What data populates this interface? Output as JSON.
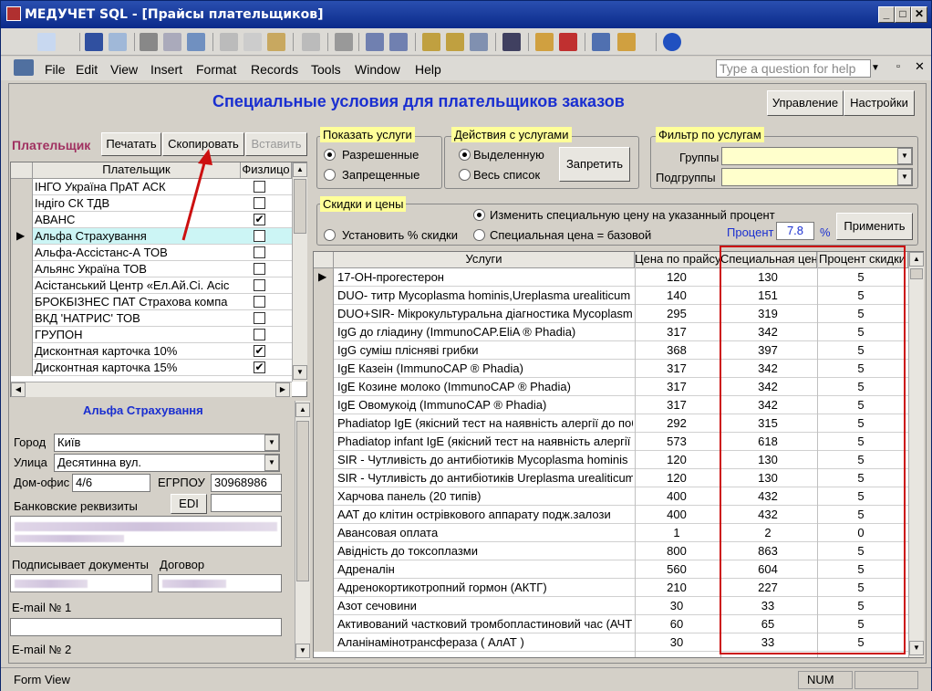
{
  "window": {
    "title": "МЕДУЧЕТ SQL - [Прайсы плательщиков]"
  },
  "menu": {
    "items": [
      "File",
      "Edit",
      "View",
      "Insert",
      "Format",
      "Records",
      "Tools",
      "Window",
      "Help"
    ],
    "ask_placeholder": "Type a question for help"
  },
  "form": {
    "title": "Специальные условия для плательщиков заказов",
    "btn_manage": "Управление",
    "btn_settings": "Настройки"
  },
  "payer_panel": {
    "label": "Плательщик",
    "btn_print": "Печатать",
    "btn_copy": "Скопировать",
    "btn_paste": "Вставить",
    "col_payer": "Плательщик",
    "col_individual": "Физлицо",
    "rows": [
      {
        "name": "ІНГО Україна ПрАТ АСК",
        "checked": false
      },
      {
        "name": "Індіго СК ТДВ",
        "checked": false
      },
      {
        "name": "АВАНС",
        "checked": true
      },
      {
        "name": "Альфа Страхування",
        "checked": false
      },
      {
        "name": "Альфа-Ассістанс-А ТОВ",
        "checked": false
      },
      {
        "name": "Альянс Україна ТОВ",
        "checked": false
      },
      {
        "name": "Асістанський Центр «Ел.Ай.Сі. Асіс",
        "checked": false
      },
      {
        "name": "БРОКБІЗНЕС ПАТ Страхова компа",
        "checked": false
      },
      {
        "name": "ВКД 'НАТРИС' ТОВ",
        "checked": false
      },
      {
        "name": "ГРУПОН",
        "checked": false
      },
      {
        "name": "Дисконтная карточка 10%",
        "checked": true
      },
      {
        "name": "Дисконтная карточка 15%",
        "checked": true
      }
    ]
  },
  "details": {
    "name": "Альфа Страхування",
    "city_label": "Город",
    "city": "Київ",
    "street_label": "Улица",
    "street": "Десятинна вул.",
    "office_label": "Дом-офис",
    "office": "4/6",
    "edrpou_label": "ЕГРПОУ",
    "edrpou": "30968986",
    "bank_label": "Банковские реквизиты",
    "edi_label": "EDI",
    "signer_label": "Подписывает документы",
    "contract_label": "Договор",
    "email1_label": "E-mail № 1",
    "email2_label": "E-mail № 2"
  },
  "show_services": {
    "title": "Показать услуги",
    "opt1": "Разрешенные",
    "opt2": "Запрещенные",
    "selected": 1
  },
  "actions": {
    "title": "Действия с услугами",
    "opt1": "Выделенную",
    "opt2": "Весь список",
    "selected": 1,
    "btn": "Запретить"
  },
  "filter": {
    "title": "Фильтр по услугам",
    "groups_label": "Группы",
    "subgroups_label": "Подгруппы"
  },
  "discounts": {
    "title": "Скидки и цены",
    "opt_set": "Установить % скидки",
    "opt_change": "Изменить специальную цену на указанный процент",
    "opt_base": "Специальная цена = базовой",
    "selected": "change",
    "percent_label": "Процент",
    "percent_value": "7.8",
    "percent_sign": "%",
    "apply": "Применить"
  },
  "services": {
    "headers": [
      "Услуги",
      "Цена по прайсу",
      "Специальная цена",
      "Процент скидки"
    ],
    "rows": [
      [
        "17-ОН-прогестерон",
        "120",
        "130",
        "5"
      ],
      [
        "DUO- титр  Mycoplasma hominis,Ureplasma urealiticum",
        "140",
        "151",
        "5"
      ],
      [
        "DUO+SIR- Мікрокультуральна діагностика Mycoplasma",
        "295",
        "319",
        "5"
      ],
      [
        "IgG до гліадину (ImmunoCAP.EliA ® Phadia)",
        "317",
        "342",
        "5"
      ],
      [
        "IgG суміш пліснявi грибки",
        "368",
        "397",
        "5"
      ],
      [
        "IgE Казеін (ImmunoCAP ® Phadia)",
        "317",
        "342",
        "5"
      ],
      [
        "IgE Козине молоко  (ImmunoCAP ® Phadia)",
        "317",
        "342",
        "5"
      ],
      [
        "IgE Овомукоід (ImmunoCAP ® Phadia)",
        "317",
        "342",
        "5"
      ],
      [
        "Phadiatop IgE (якісний тест на наявність алергії до поб",
        "292",
        "315",
        "5"
      ],
      [
        "Phadiatop infant IgE (якісний тест на наявність алергії ,",
        "573",
        "618",
        "5"
      ],
      [
        "SIR - Чутливість до антибіотиків Mycoplasma hominis",
        "120",
        "130",
        "5"
      ],
      [
        "SIR - Чутливість до антибіотиків Ureplasma urealiticum",
        "120",
        "130",
        "5"
      ],
      [
        "Харчова панель (20 типів)",
        "400",
        "432",
        "5"
      ],
      [
        "ААТ до клітин острівкового аппарату подж.залози",
        "400",
        "432",
        "5"
      ],
      [
        "Авансовая оплата",
        "1",
        "2",
        "0"
      ],
      [
        "Авідність до токсоплазми",
        "800",
        "863",
        "5"
      ],
      [
        "Адреналін",
        "560",
        "604",
        "5"
      ],
      [
        "Адренокортикотропний гормон (АКТГ)",
        "210",
        "227",
        "5"
      ],
      [
        "Азот сечовини",
        "30",
        "33",
        "5"
      ],
      [
        "Активований частковий тромбопластиновий час (АЧТЧ",
        "60",
        "65",
        "5"
      ],
      [
        "Аланінамінотрансфераза ( АлАТ )",
        "30",
        "33",
        "5"
      ]
    ]
  },
  "status": {
    "left": "Form View",
    "num": "NUM"
  },
  "colors": {
    "title_blue": "#1a2fd0",
    "highlight_red": "#cc1010",
    "header_yellow": "#ffff99"
  }
}
